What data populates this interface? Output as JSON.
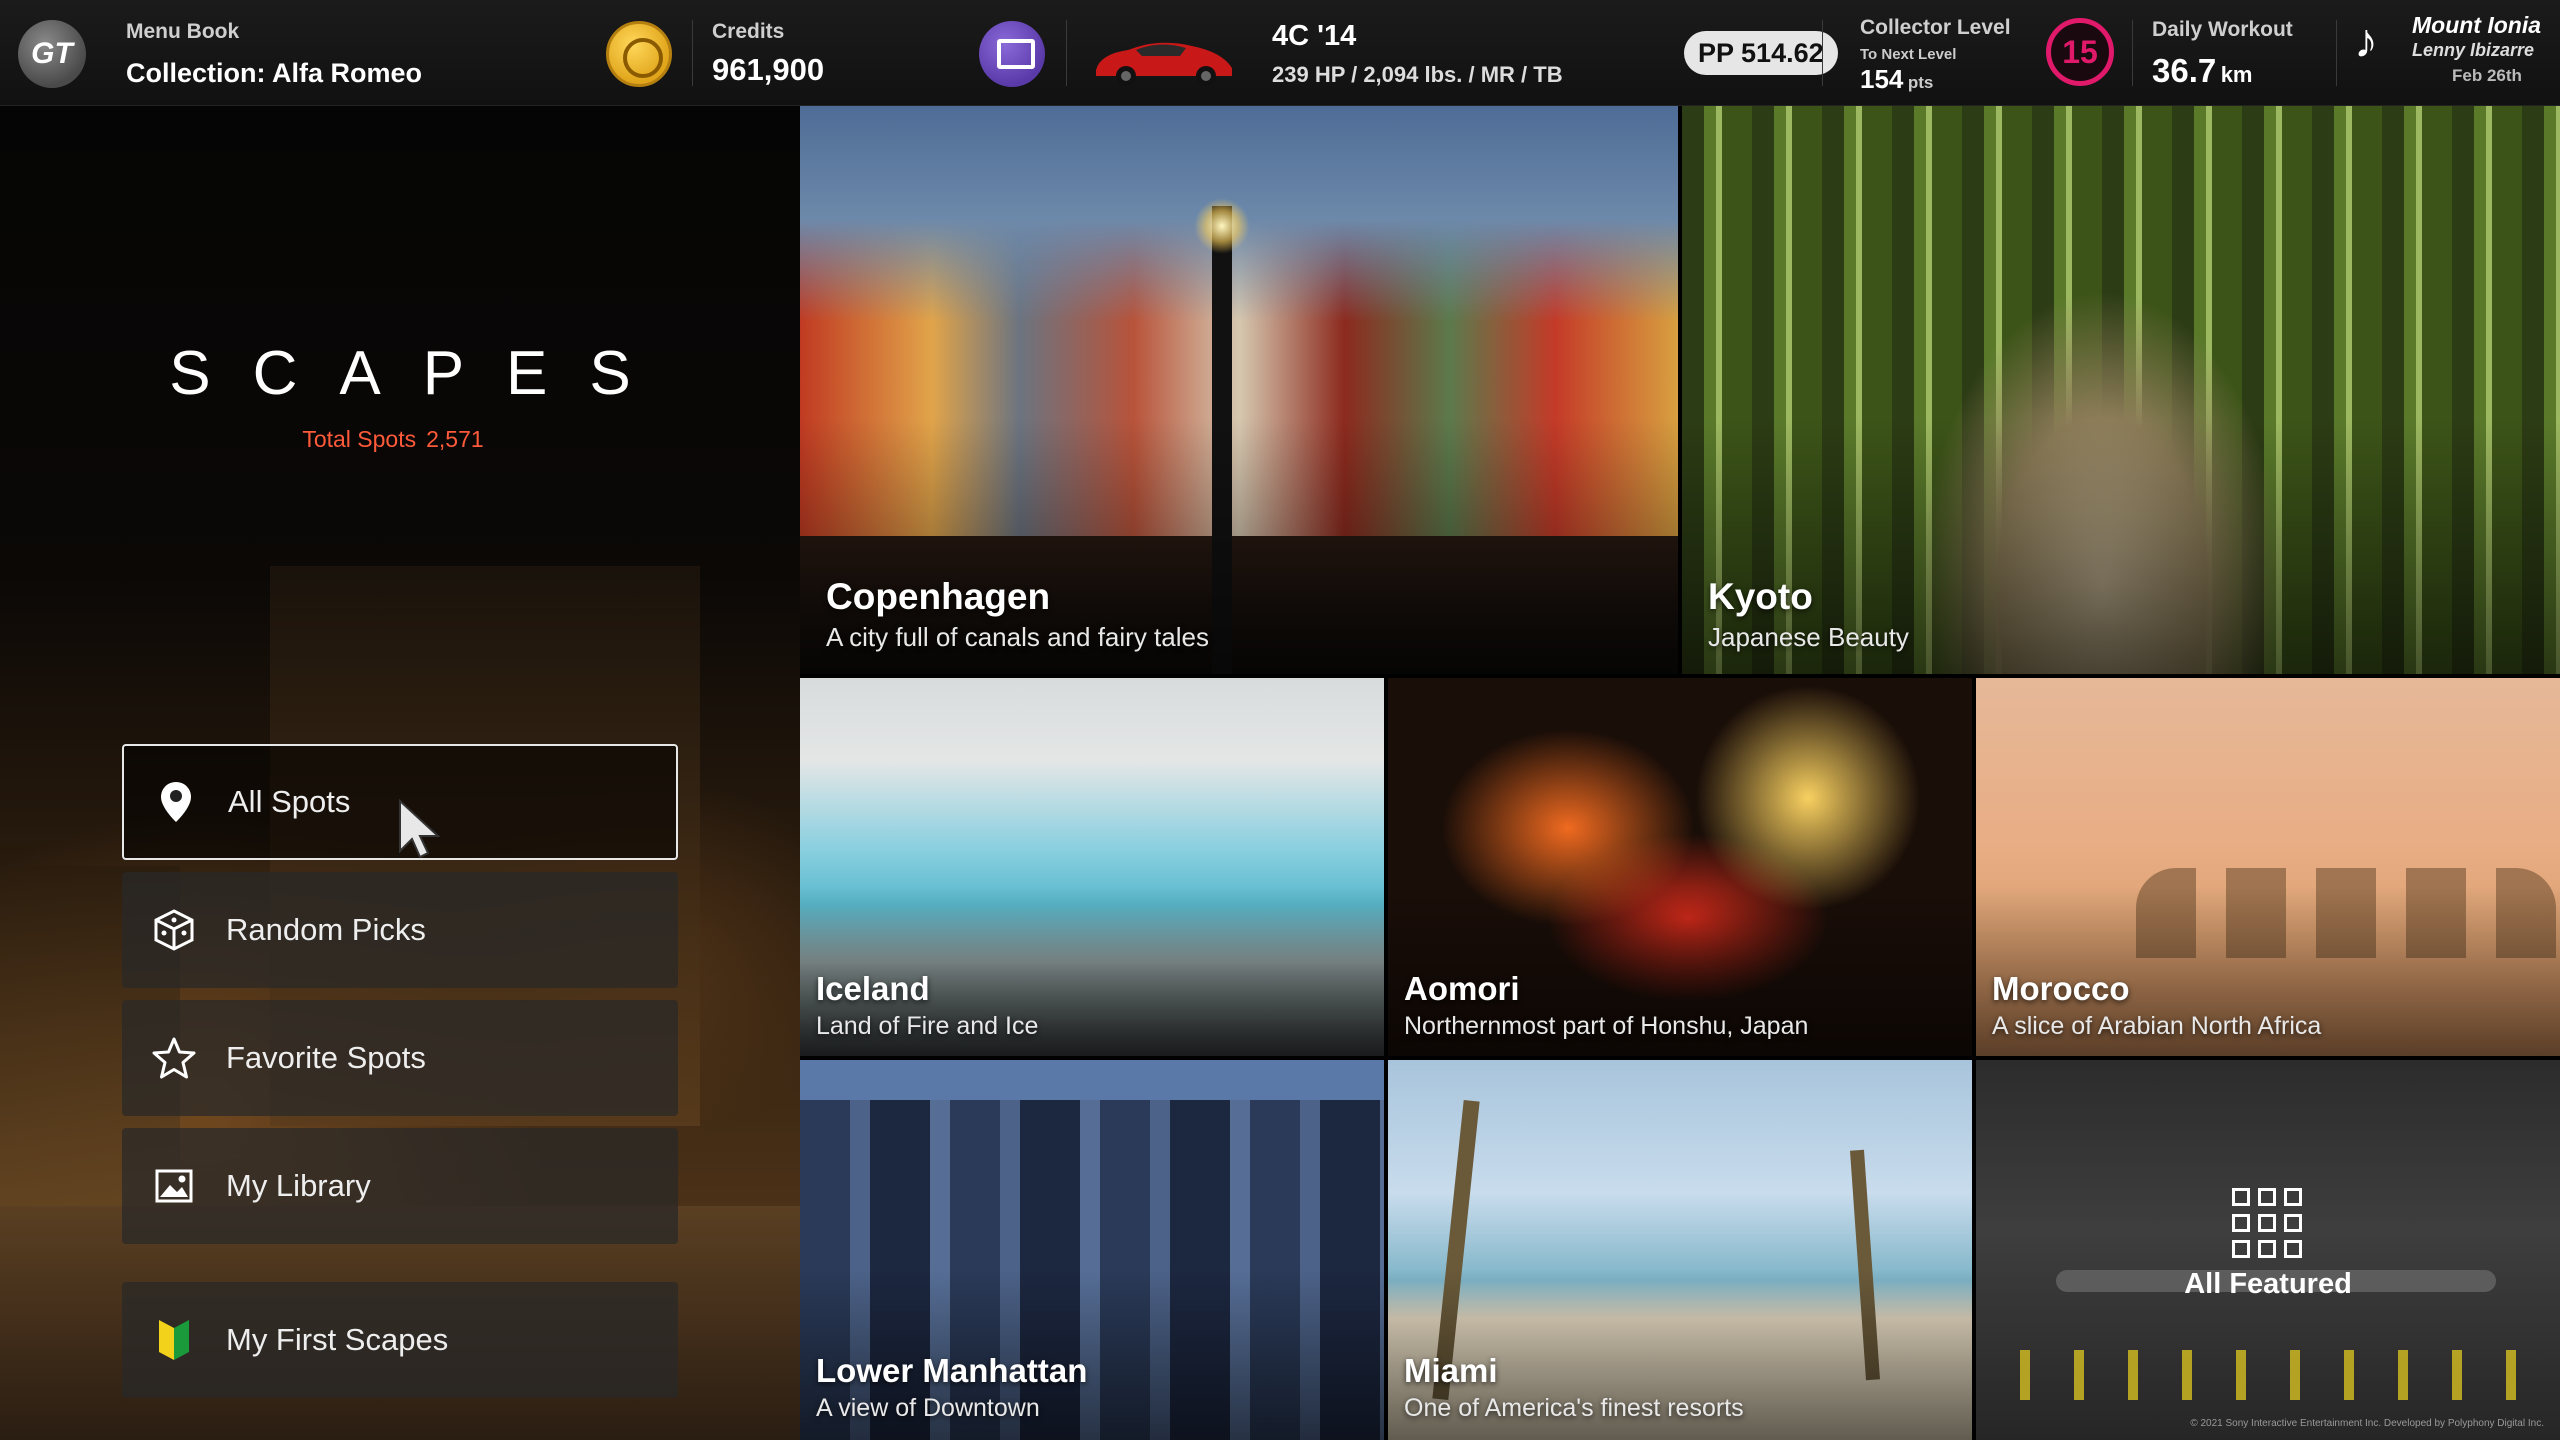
{
  "topbar": {
    "menu_label": "Menu Book",
    "collection": "Collection: Alfa Romeo",
    "credits_label": "Credits",
    "credits_value": "961,900",
    "car_name": "4C '14",
    "car_specs": "239 HP / 2,094 lbs. / MR / TB",
    "pp": "PP 514.62",
    "collector_label": "Collector Level",
    "collector_next": "To Next Level",
    "collector_pts": "154",
    "collector_pts_unit": "pts",
    "collector_level": "15",
    "workout_label": "Daily Workout",
    "workout_value": "36.7",
    "workout_unit": "km",
    "music_title": "Mount Ionia",
    "music_artist": "Lenny Ibizarre",
    "date": "Feb 26th"
  },
  "left": {
    "title": "SCAPES",
    "total_label": "Total Spots",
    "total_value": "2,571",
    "menu": [
      {
        "label": "All Spots",
        "icon": "location-pin-icon",
        "selected": true
      },
      {
        "label": "Random Picks",
        "icon": "dice-icon"
      },
      {
        "label": "Favorite Spots",
        "icon": "star-icon"
      },
      {
        "label": "My Library",
        "icon": "image-icon"
      },
      {
        "label": "My First Scapes",
        "icon": "beginner-leaf-icon"
      }
    ]
  },
  "tiles": [
    {
      "name": "Copenhagen",
      "desc": "A city full of canals and fairy tales"
    },
    {
      "name": "Kyoto",
      "desc": "Japanese Beauty"
    },
    {
      "name": "Iceland",
      "desc": "Land of Fire and Ice"
    },
    {
      "name": "Aomori",
      "desc": "Northernmost part of Honshu, Japan"
    },
    {
      "name": "Morocco",
      "desc": "A slice of Arabian North Africa"
    },
    {
      "name": "Lower Manhattan",
      "desc": "A view of Downtown"
    },
    {
      "name": "Miami",
      "desc": "One of America's finest resorts"
    },
    {
      "name": "All Featured",
      "icon": "grid-icon"
    }
  ],
  "copyright": "© 2021 Sony Interactive Entertainment Inc. Developed by Polyphony Digital Inc.",
  "colors": {
    "accent_red": "#ff5a3a",
    "level_ring": "#e0196a",
    "credits_gold": "#e0a51a"
  }
}
